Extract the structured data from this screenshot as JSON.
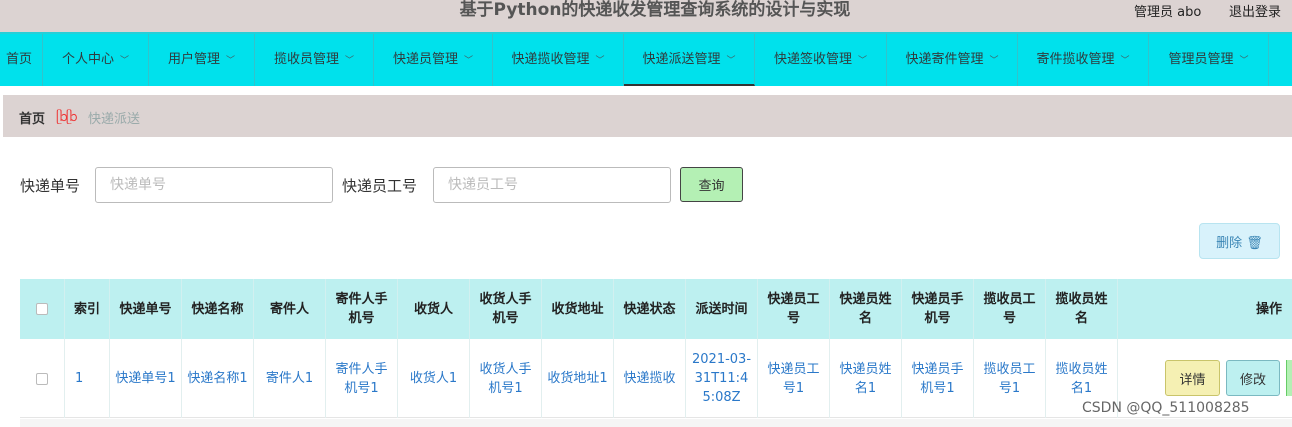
{
  "header": {
    "title": "基于Python的快递收发管理查询系统的设计与实现",
    "admin_label": "管理员 abo",
    "logout_label": "退出登录"
  },
  "nav": {
    "items": [
      {
        "label": "首页"
      },
      {
        "label": "个人中心"
      },
      {
        "label": "用户管理"
      },
      {
        "label": "揽收员管理"
      },
      {
        "label": "快递员管理"
      },
      {
        "label": "快递揽收管理"
      },
      {
        "label": "快递派送管理"
      },
      {
        "label": "快递签收管理"
      },
      {
        "label": "快递寄件管理"
      },
      {
        "label": "寄件揽收管理"
      },
      {
        "label": "管理员管理"
      }
    ],
    "active": "快递派送管理"
  },
  "breadcrumb": {
    "home": "首页",
    "separator": "ᥫᩣᥫᩣ",
    "current": "快递派送"
  },
  "search": {
    "field1_label": "快递单号",
    "field1_placeholder": "快递单号",
    "field2_label": "快递员工号",
    "field2_placeholder": "快递员工号",
    "query_label": "查询"
  },
  "toolbar": {
    "delete_label": "删除 🗑"
  },
  "table": {
    "columns": [
      "",
      "索引",
      "快递单号",
      "快递名称",
      "寄件人",
      "寄件人手机号",
      "收货人",
      "收货人手机号",
      "收货地址",
      "快递状态",
      "派送时间",
      "快递员工号",
      "快递员姓名",
      "快递员手机号",
      "揽收员工号",
      "揽收员姓名",
      "操作"
    ],
    "rows": [
      {
        "cells": [
          "",
          "1",
          "快递单号1",
          "快递名称1",
          "寄件人1",
          "寄件人手机号1",
          "收货人1",
          "收货人手机号1",
          "收货地址1",
          "快递揽收",
          "2021-03-31T11:45:08Z",
          "快递员工号1",
          "快递员姓名1",
          "快递员手机号1",
          "揽收员工号1",
          "揽收员姓名1"
        ],
        "actions": {
          "detail": "详情",
          "edit": "修改"
        }
      }
    ]
  },
  "watermark": "CSDN @QQ_511008285"
}
